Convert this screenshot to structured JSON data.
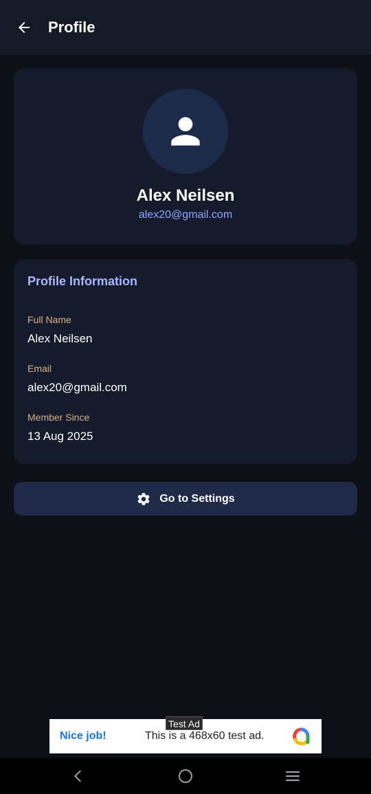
{
  "appbar": {
    "title": "Profile",
    "back_icon": "arrow-left-icon"
  },
  "profile": {
    "avatar_icon": "person-icon",
    "name": "Alex Neilsen",
    "email": "alex20@gmail.com"
  },
  "info": {
    "title": "Profile Information",
    "fields": [
      {
        "label": "Full Name",
        "value": "Alex Neilsen"
      },
      {
        "label": "Email",
        "value": "alex20@gmail.com"
      },
      {
        "label": "Member Since",
        "value": "13 Aug 2025"
      }
    ]
  },
  "settings_button": {
    "label": "Go to Settings",
    "icon": "gear-icon"
  },
  "ad": {
    "tag": "Test Ad",
    "headline": "Nice job!",
    "body": "This is a 468x60 test ad.",
    "logo_icon": "admob-logo-icon"
  },
  "navbar": {
    "back_icon": "chevron-left-icon",
    "home_icon": "circle-home-icon",
    "recents_icon": "menu-lines-icon"
  },
  "colors": {
    "background": "#0d1017",
    "appbar": "#141a26",
    "card": "#151b2a",
    "accent": "#a9b7ff",
    "email": "#8ea7ff",
    "label": "#d6b28a",
    "button": "#1e2a47"
  }
}
